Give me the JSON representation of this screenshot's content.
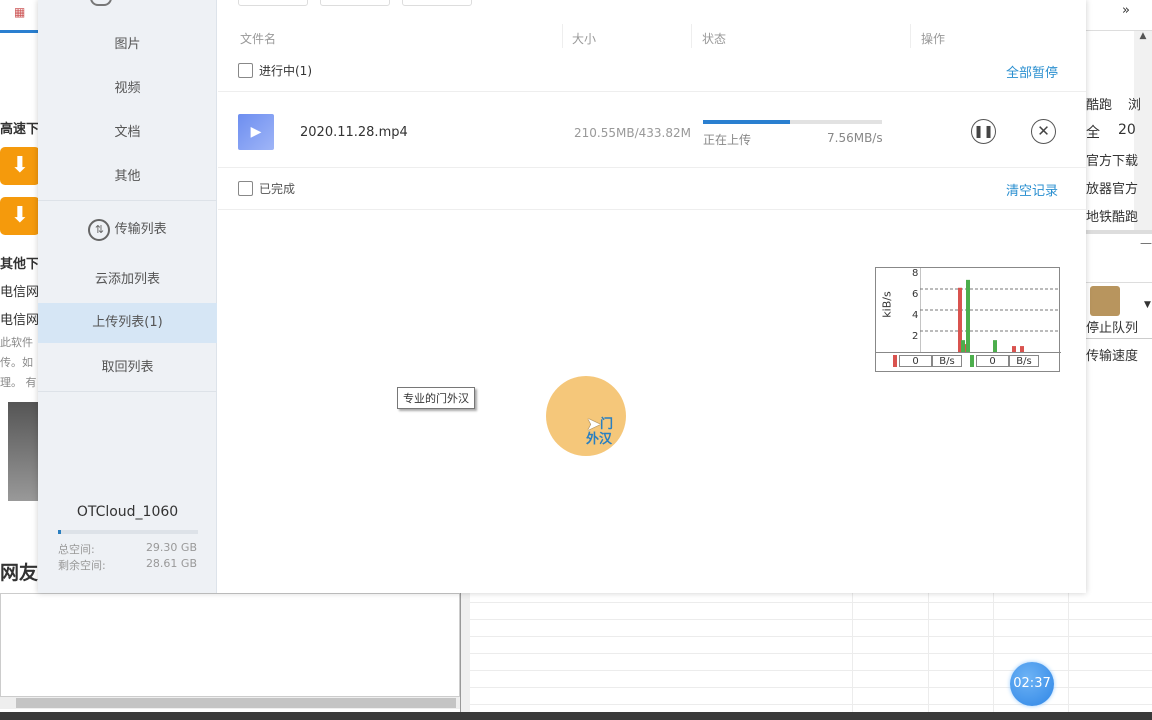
{
  "background_page": {
    "left_texts": [
      "高速下",
      "其他下",
      "电信网",
      "电信网",
      "此软件",
      "传。如",
      "理。 有",
      "网友"
    ],
    "right_texts": [
      "酷跑",
      "浏",
      "全",
      "20",
      "官方下载",
      "放器官方",
      "地铁酷跑"
    ],
    "right_toolbar_label": "停止队列",
    "right_speed_label": "传输速度",
    "more_icon": "double-chevron-right",
    "timer": "02:37"
  },
  "sidebar": {
    "items": [
      {
        "label": "图片"
      },
      {
        "label": "视频"
      },
      {
        "label": "文档"
      },
      {
        "label": "其他"
      }
    ],
    "transfer_header": "传输列表",
    "transfer_items": [
      {
        "label": "云添加列表",
        "active": false
      },
      {
        "label": "上传列表(1)",
        "active": true
      },
      {
        "label": "取回列表",
        "active": false
      }
    ],
    "account": {
      "name": "OTCloud_1060",
      "used_fraction": 0.024,
      "total_label": "总空间:",
      "total_value": "29.30 GB",
      "free_label": "剩余空间:",
      "free_value": "28.61 GB"
    }
  },
  "main": {
    "columns": [
      "文件名",
      "大小",
      "状态",
      "操作"
    ],
    "in_progress": {
      "label": "进行中(1)",
      "action": "全部暂停"
    },
    "files": [
      {
        "name": "2020.11.28.mp4",
        "size": "210.55MB/433.82MB",
        "status": "正在上传",
        "speed": "7.56MB/s",
        "progress": 0.485,
        "icon": "video-file-icon"
      }
    ],
    "completed": {
      "label": "已完成",
      "action": "清空记录"
    }
  },
  "speed_widget": {
    "y_label": "kiB/s",
    "y_ticks": [
      "8",
      "6",
      "4",
      "2"
    ],
    "upload_value": "0",
    "upload_unit": "B/s",
    "download_value": "0",
    "download_unit": "B/s",
    "colors": {
      "upload": "#d9534f",
      "download": "#4cae4c",
      "overlap": "#f0c040"
    }
  },
  "tooltip": {
    "text": "专业的门外汉"
  },
  "floating_ball": {
    "text_line1": "门",
    "text_line2": "外汉",
    "color": "#f5c77a"
  },
  "chart_data": {
    "type": "bar",
    "ylabel": "kiB/s",
    "ylim": [
      0,
      8.5
    ],
    "series": [
      {
        "values": [
          6.5,
          0.8,
          0,
          0,
          0.6,
          0.6
        ]
      },
      {
        "values": [
          1.2,
          7.3,
          1.2,
          0,
          0,
          0
        ]
      }
    ]
  }
}
